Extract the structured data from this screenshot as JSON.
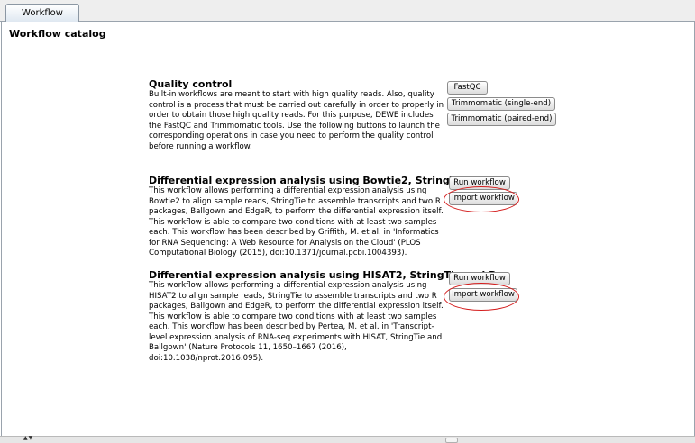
{
  "tab": {
    "label": "Workflow catalog"
  },
  "page": {
    "title": "Workflow catalog"
  },
  "sections": [
    {
      "title": "Quality control",
      "description": "Built-in workflows are meant to start with high quality reads. Also, quality control is a process that must be carried out carefully in order to properly in order to obtain those high quality reads. For this purpose, DEWE includes the FastQC and Trimmomatic tools. Use the following buttons to launch the corresponding operations in case you need to perform the quality control before running a workflow.",
      "buttons": [
        "FastQC",
        "Trimmomatic (single-end)",
        "Trimmomatic (paired-end)"
      ]
    },
    {
      "title": "Differential expression analysis using Bowtie2, StringTie and R",
      "description": "This workflow allows performing a differential expression analysis using Bowtie2 to align sample reads, StringTie to assemble transcripts and two R packages, Ballgown and EdgeR, to perform the differential expression itself. This workflow is able to compare two conditions with at least two samples each. This workflow has been described by Griffith, M. et al. in 'Informatics for RNA Sequencing: A Web Resource for Analysis on the Cloud' (PLOS Computational Biology (2015), doi:10.1371/journal.pcbi.1004393).",
      "buttons": [
        "Run workflow",
        "Import workflow"
      ]
    },
    {
      "title": "Differential expression analysis using HISAT2, StringTie and R",
      "description": "This workflow allows performing a differential expression analysis using HISAT2 to align sample reads, StringTie to assemble transcripts and two R packages, Ballgown and EdgeR, to perform the differential expression itself. This workflow is able to compare two conditions with at least two samples each. This workflow has been described by Pertea, M. et al. in 'Transcript-level expression analysis of RNA-seq experiments with HISAT, StringTie and Ballgown' (Nature Protocols 11, 1650–1667 (2016), doi:10.1038/nprot.2016.095).",
      "buttons": [
        "Run workflow",
        "Import workflow"
      ]
    }
  ],
  "colors": {
    "highlight": "#d41c1c",
    "tab_border": "#8c97a3"
  }
}
